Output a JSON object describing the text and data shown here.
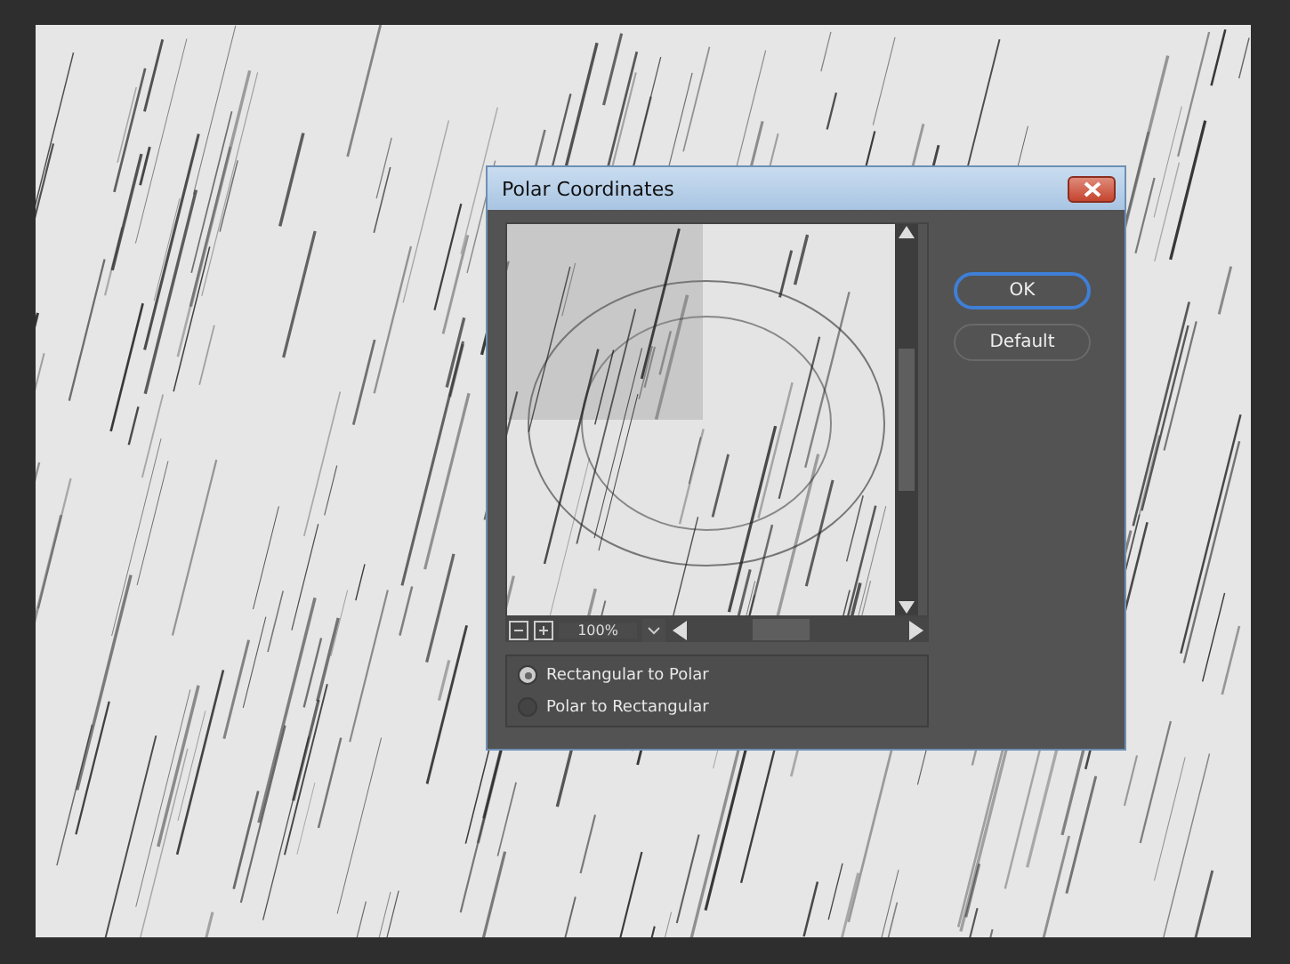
{
  "dialog": {
    "title": "Polar Coordinates",
    "preview": {
      "zoom": "100%"
    },
    "options": [
      {
        "label": "Rectangular to Polar",
        "selected": true
      },
      {
        "label": "Polar to Rectangular",
        "selected": false
      }
    ],
    "buttons": [
      {
        "label": "OK",
        "focused": true
      },
      {
        "label": "Default",
        "focused": false
      }
    ]
  }
}
